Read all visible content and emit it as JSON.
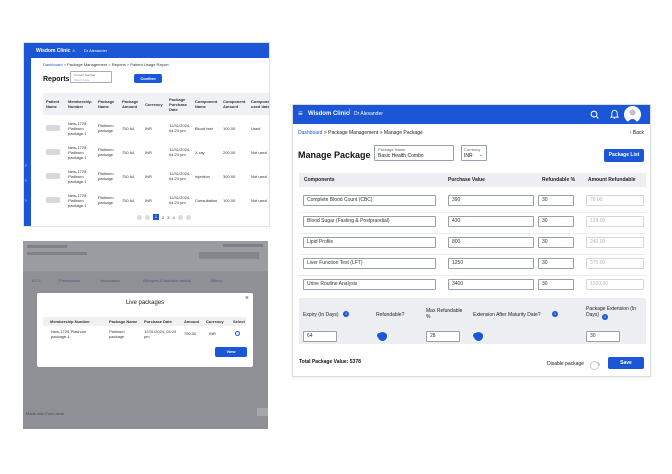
{
  "reports": {
    "app_name": "Wisdom Clinic",
    "user": "Dr Alexander",
    "breadcrumb": [
      "Dashboard",
      "Package Management",
      "Reports",
      "Patient Usage Report"
    ],
    "title": "Reports",
    "field_label": "Current Number",
    "field_value": "Select Date",
    "confirm_label": "Confirm",
    "columns": [
      "Patient Name",
      "Membership Number",
      "Package Name",
      "Package Amount",
      "Currency",
      "Package Purchase Date",
      "Component Name",
      "Component Amount",
      "Component used date"
    ],
    "rows": [
      {
        "membership": "New-1729-Platinum package-1",
        "package": "Platinum package",
        "amount": "750.64",
        "currency": "INR",
        "date": "12/31/2024, 04:24 pm",
        "component": "Blood test",
        "camount": "100.00",
        "used": "Used"
      },
      {
        "membership": "New-1729-Platinum package-1",
        "package": "Platinum package",
        "amount": "750.64",
        "currency": "INR",
        "date": "12/31/2024, 04:24 pm",
        "component": "X-ray",
        "camount": "200.00",
        "used": "Not used"
      },
      {
        "membership": "New-1729-Platinum package-1",
        "package": "Platinum package",
        "amount": "750.64",
        "currency": "INR",
        "date": "12/31/2024, 04:24 pm",
        "component": "Injection",
        "camount": "300.00",
        "used": "Not used"
      },
      {
        "membership": "New-1729-Platinum package-1",
        "package": "Platinum package",
        "amount": "750.64",
        "currency": "INR",
        "date": "12/31/2024, 04:24 pm",
        "component": "Consultation",
        "camount": "100.00",
        "used": "Not used"
      }
    ],
    "pages": [
      "1",
      "2",
      "3",
      "4"
    ]
  },
  "live": {
    "title": "Live packages",
    "close": "×",
    "columns": [
      "Membership Number",
      "Package Name",
      "Purchase Date",
      "Amount",
      "Currency",
      "Select"
    ],
    "row": {
      "membership": "New-1729-Platinum package-1",
      "package": "Platinum package",
      "date": "12/31/2024, 04:24 pm",
      "amount": "750.00",
      "currency": "INR"
    },
    "view_label": "View",
    "bg_tabs": [
      "ECG",
      "Prescription",
      "Vaccination",
      "Allergies & Nutrition details",
      "Billing"
    ],
    "bg_footer": "Made with Form.desk"
  },
  "manage": {
    "app_name": "Wisdom Clinic",
    "user": "Dr Alexander",
    "breadcrumb": [
      "Dashboard",
      "Package Management",
      "Manage Package"
    ],
    "back_label": "Back",
    "title": "Manage Package",
    "package_name_label": "Package Name",
    "package_name_value": "Basic Health Combo",
    "currency_label": "Currency",
    "currency_value": "INR",
    "package_list_label": "Package List",
    "columns": [
      "Components",
      "Purchase Value",
      "Refundable %",
      "Amount Refundable"
    ],
    "rows": [
      {
        "component": "Complete Blood Count (CBC)",
        "value": "390",
        "refund_pct": "30",
        "refund_amt": "78.00"
      },
      {
        "component": "Blood Sugar (Fasting & Postprandial)",
        "value": "430",
        "refund_pct": "30",
        "refund_amt": "129.00"
      },
      {
        "component": "Lipid Profile",
        "value": "800",
        "refund_pct": "30",
        "refund_amt": "240.00"
      },
      {
        "component": "Liver Function Test (LFT)",
        "value": "1250",
        "refund_pct": "30",
        "refund_amt": "375.00"
      },
      {
        "component": "Urine Routine Analysis",
        "value": "3400",
        "refund_pct": "30",
        "refund_amt": "1020.00"
      }
    ],
    "settings_labels": {
      "expiry": "Expiry (In Days)",
      "refundable": "Refundable?",
      "max_refund": "Max Refundable %",
      "extension_after": "Extension After Maturity Date?",
      "extension_days": "Package Extension (In Days)"
    },
    "settings_values": {
      "expiry": "64",
      "max_refund": "28",
      "extension_days": "30"
    },
    "total_label": "Total Package Value: 5378",
    "disable_label": "Disable package",
    "save_label": "Save"
  }
}
